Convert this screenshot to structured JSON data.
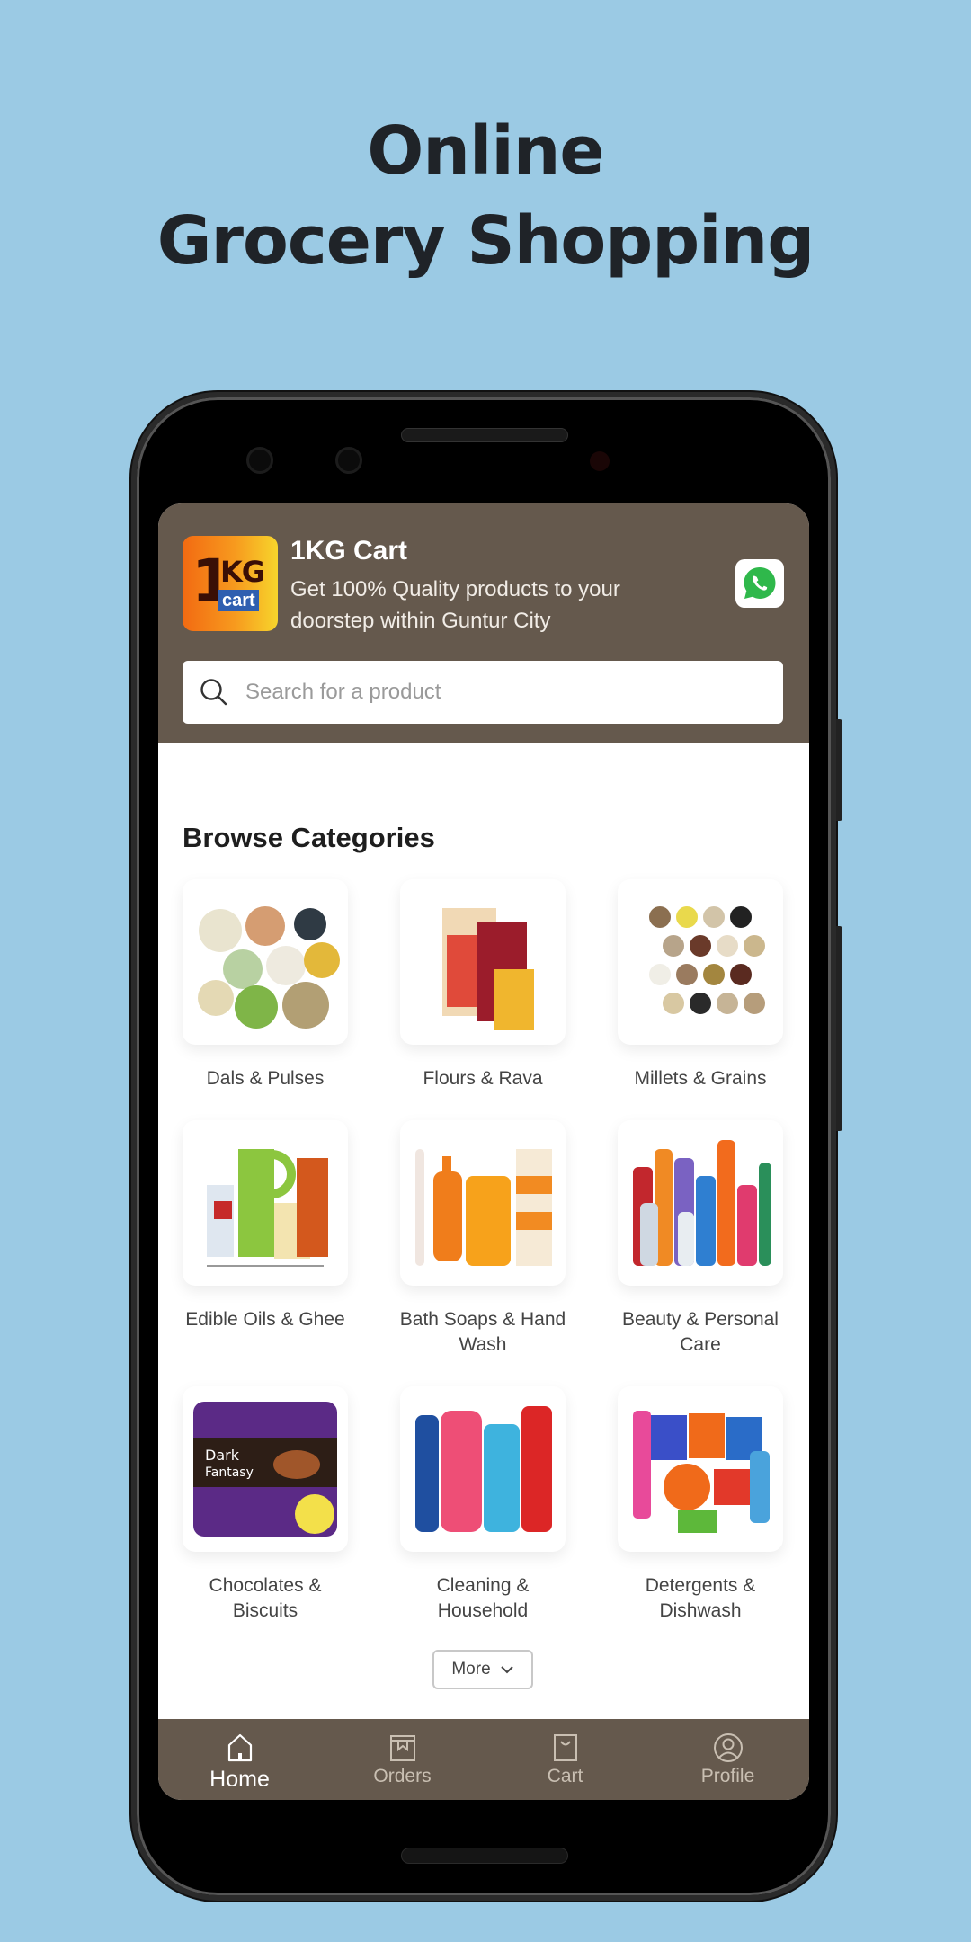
{
  "promo": {
    "headline_line1": "Online",
    "headline_line2": "Grocery Shopping",
    "background_color": "#9bcae4"
  },
  "app": {
    "name": "1KG Cart",
    "tagline": "Get 100% Quality products to your doorstep within Guntur City",
    "logo": {
      "main": "1",
      "kg": "KG",
      "sub": "cart"
    },
    "header_color": "#65594d",
    "whatsapp_icon": "whatsapp-icon"
  },
  "search": {
    "placeholder": "Search for a product",
    "value": "",
    "icon": "search-icon"
  },
  "categories": {
    "title": "Browse Categories",
    "items": [
      {
        "label": "Dals & Pulses",
        "image": "dals-pulses-image"
      },
      {
        "label": "Flours & Rava",
        "image": "flours-rava-image"
      },
      {
        "label": "Millets & Grains",
        "image": "millets-grains-image"
      },
      {
        "label": "Edible Oils & Ghee",
        "image": "edible-oils-ghee-image"
      },
      {
        "label": "Bath Soaps & Hand Wash",
        "image": "bath-soaps-image"
      },
      {
        "label": "Beauty & Personal Care",
        "image": "beauty-care-image"
      },
      {
        "label": "Chocolates & Biscuits",
        "image": "chocolates-biscuits-image"
      },
      {
        "label": "Cleaning & Household",
        "image": "cleaning-household-image"
      },
      {
        "label": "Detergents & Dishwash",
        "image": "detergents-dishwash-image"
      }
    ],
    "more_label": "More"
  },
  "bottom_nav": {
    "items": [
      {
        "label": "Home",
        "icon": "home-icon",
        "active": true
      },
      {
        "label": "Orders",
        "icon": "orders-icon",
        "active": false
      },
      {
        "label": "Cart",
        "icon": "cart-icon",
        "active": false
      },
      {
        "label": "Profile",
        "icon": "profile-icon",
        "active": false
      }
    ]
  }
}
